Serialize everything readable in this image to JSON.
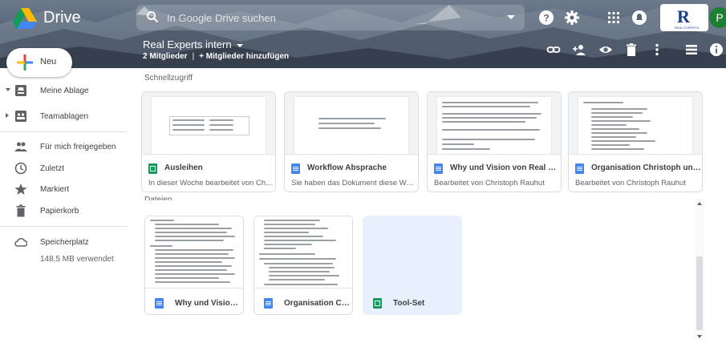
{
  "header": {
    "app_name": "Drive",
    "search_placeholder": "In Google Drive suchen",
    "icons": [
      "help-icon",
      "settings-icon",
      "apps-grid-icon",
      "notifications-icon"
    ],
    "brand_logo_letter": "R",
    "brand_logo_sub": "REAL EXPERTS",
    "avatar_letter": "P"
  },
  "team": {
    "title": "Real Experts intern",
    "members": "2 Mitglieder",
    "separator": "|",
    "add_members": "+ Mitglieder hinzufügen",
    "toolbar_icons": [
      "link-icon",
      "add-person-icon",
      "preview-icon",
      "trash-icon",
      "more-vert-icon",
      "list-view-icon",
      "info-icon"
    ]
  },
  "new_button": {
    "label": "Neu"
  },
  "sidebar": {
    "items": [
      {
        "label": "Meine Ablage",
        "icon": "my-drive-icon",
        "arrow": "down"
      },
      {
        "label": "Teamablagen",
        "icon": "team-drives-icon",
        "arrow": "right"
      },
      {
        "label": "Für mich freigegeben",
        "icon": "shared-with-me-icon"
      },
      {
        "label": "Zuletzt",
        "icon": "recent-clock-icon"
      },
      {
        "label": "Markiert",
        "icon": "star-icon"
      },
      {
        "label": "Papierkorb",
        "icon": "trash-icon"
      }
    ],
    "storage": {
      "label": "Speicherplatz",
      "used": "148,5 MB verwendet",
      "icon": "cloud-icon"
    }
  },
  "quick_access": {
    "title": "Schnellzugriff",
    "cards": [
      {
        "name": "Ausleihen",
        "type": "sheet",
        "sub": "In dieser Woche bearbeitet von Christo..."
      },
      {
        "name": "Workflow Absprache",
        "type": "doc",
        "sub": "Sie haben das Dokument diese Woche..."
      },
      {
        "name": "Why und Vision von Real Expe...",
        "type": "doc",
        "sub": "Bearbeitet von Christoph Rauhut"
      },
      {
        "name": "Organisation Christoph und Pe...",
        "type": "doc",
        "sub": "Bearbeitet von Christoph Rauhut"
      }
    ]
  },
  "files": {
    "section_label": "Dateien",
    "cards": [
      {
        "name": "Why und Vision v...",
        "type": "doc",
        "selected": false
      },
      {
        "name": "Organisation Chri...",
        "type": "doc",
        "selected": false
      },
      {
        "name": "Tool-Set",
        "type": "sheet",
        "selected": true
      }
    ]
  },
  "colors": {
    "doc_blue": "#4285f4",
    "sheet_green": "#0f9d58",
    "selected_bg": "#e8f0fe",
    "avatar_green": "#1e7e34"
  }
}
